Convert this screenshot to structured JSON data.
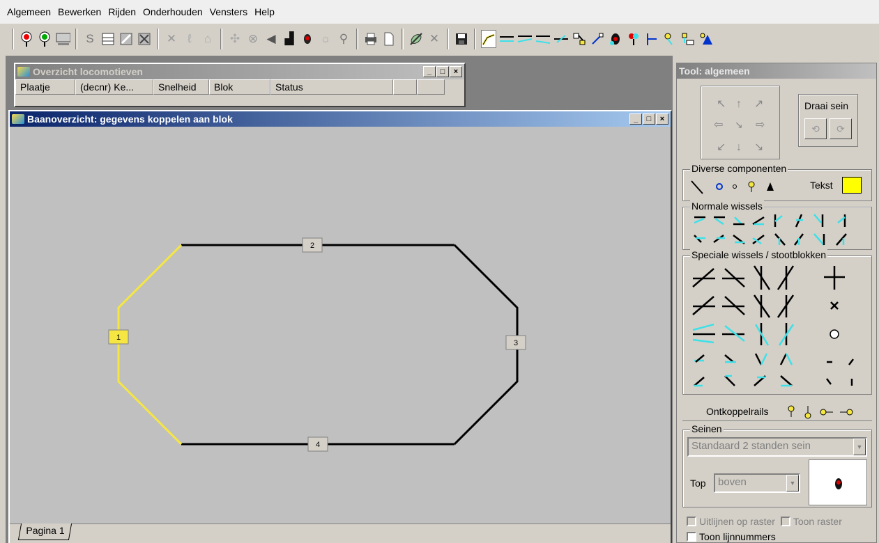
{
  "menu": [
    "Algemeen",
    "Bewerken",
    "Rijden",
    "Onderhouden",
    "Vensters",
    "Help"
  ],
  "toolbar_icons": [
    "signal-red-icon",
    "signal-green-icon",
    "keyboard-icon",
    "s-icon",
    "list-icon",
    "track-icon",
    "grid-icon",
    "cross-icon",
    "bolt-icon",
    "ghost-icon",
    "fork-icon",
    "circle-icon",
    "speaker-icon",
    "loco-icon",
    "red-dot-icon",
    "sun-icon",
    "switch-icon",
    "printer-icon",
    "page-icon",
    "pen-icon",
    "close-icon",
    "save-icon",
    "track-select-icon",
    "wissel-icon",
    "wissel2-icon",
    "wissel3-icon",
    "wissel4-icon",
    "block-icon",
    "line-icon",
    "signal-icon",
    "signal2-icon",
    "flag-icon",
    "key-icon",
    "block2-icon",
    "triangle-icon"
  ],
  "loco_window": {
    "title": "Overzicht locomotieven",
    "columns": [
      "Plaatje",
      "(decnr) Ke...",
      "Snelheid",
      "Blok",
      "Status",
      "",
      ""
    ]
  },
  "track_window": {
    "title": "Baanoverzicht: gegevens koppelen aan blok",
    "blocks": [
      "1",
      "2",
      "3",
      "4"
    ],
    "tab": "Pagina 1"
  },
  "tool_panel": {
    "title": "Tool: algemeen",
    "draai_sein": "Draai sein",
    "diverse_label": "Diverse componenten",
    "tekst_label": "Tekst",
    "normale_label": "Normale wissels",
    "speciale_label": "Speciale wissels / stootblokken",
    "ontkoppel_label": "Ontkoppelrails",
    "seinen_label": "Seinen",
    "sein_type": "Standaard 2 standen sein",
    "top_label": "Top",
    "top_value": "boven",
    "chk_uitlijnen": "Uitlijnen op raster",
    "chk_toon_raster": "Toon raster",
    "chk_lijnnummers": "Toon lijnnummers"
  },
  "colors": {
    "highlight_track": "#f5e642",
    "title_active": "#0a246a",
    "wissel_cyan": "#3ee0e8"
  }
}
